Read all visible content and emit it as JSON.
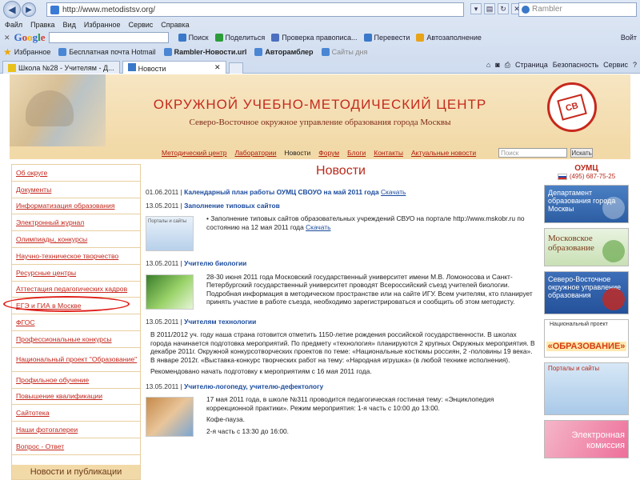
{
  "browser": {
    "url": "http://www.metodistsv.org/",
    "search_placeholder": "Rambler",
    "menu": [
      "Файл",
      "Правка",
      "Вид",
      "Избранное",
      "Сервис",
      "Справка"
    ],
    "google_toolbar": {
      "logo": [
        "G",
        "o",
        "o",
        "g",
        "l",
        "e"
      ],
      "items": [
        "Поиск",
        "Поделиться",
        "Проверка правописа...",
        "Перевести",
        "Автозаполнение"
      ],
      "signin": "Войт"
    },
    "favorites": {
      "label": "Избранное",
      "items": [
        "Бесплатная почта Hotmail",
        "Rambler-Новости.url",
        "Авторамблер",
        "Сайты дня"
      ]
    },
    "tabs": [
      {
        "label": "Школа №28 - Учителям - Д..."
      },
      {
        "label": "Новости"
      }
    ],
    "command_bar": [
      "Страница",
      "Безопасность",
      "Сервис"
    ]
  },
  "header": {
    "title": "ОКРУЖНОЙ УЧЕБНО-МЕТОДИЧЕСКИЙ ЦЕНТР",
    "subtitle": "Северо-Восточное окружное управление образования города Москвы",
    "logo_text": "СВ"
  },
  "topnav": {
    "links": [
      "Методический центр",
      "Лаборатории",
      "Новости",
      "Форум",
      "Блоги",
      "Контакты",
      "Актуальные новости"
    ],
    "search_placeholder": "Поиск",
    "search_button": "Искать"
  },
  "sidebar": {
    "items": [
      "Об округе",
      "Документы",
      "Информатизация образования",
      "Электронный журнал",
      "Олимпиады, конкурсы",
      "Научно-техническое творчество",
      "Ресурсные центры",
      "Аттестация педагогических кадров",
      "ЕГЭ и ГИА в Москве",
      "ФГОС",
      "Профессиональные конкурсы",
      "Национальный проект \"Образование\"",
      "Профильное обучение",
      "Повышение квалификации",
      "Сайтотека",
      "Наши фотогалереи",
      "Вопрос - Ответ"
    ],
    "footer": "Новости и публикации"
  },
  "main": {
    "title": "Новости",
    "news": [
      {
        "date": "01.06.2011",
        "head": "Календарный план работы ОУМЦ СВОУО на май 2011 года",
        "link": "Скачать"
      },
      {
        "date": "13.05.2011",
        "head": "Заполнение типовых сайтов",
        "thumb_label": "Порталы и сайты",
        "text": "Заполнение типовых сайтов образовательных учреждений СВУО на портале http://www.mskobr.ru по состоянию на 12 мая 2011 года",
        "link": "Скачать"
      },
      {
        "date": "13.05.2011",
        "head": "Учителю биологии",
        "text": "28-30 июня 2011 года Московский государственный университет имени М.В. Ломоносова и Санкт-Петербургский государственный университет проводят Всероссийский съезд учителей биологии. Подробная информация в методическом пространстве или на сайте ИГУ. Всем учителям, кто планирует принять участие в работе съезда, необходимо зарегистрироваться и сообщить об этом методисту."
      },
      {
        "date": "13.05.2011",
        "head": "Учителям технологии",
        "text": "В 2011/2012 уч. году наша страна готовится отметить 1150-летие рождения российской государственности. В школах города начинается подготовка мероприятий. По предмету «технология» планируются 2 крупных Окружных мероприятия. В декабре 2011г. Окружной конкурсотворческих проектов по теме: «Национальные костюмы россиян, 2 -половины 19 века». В январе 2012г. «Выставка-конкурс творческих работ на тему: «Народная игрушка» (в любой технике исполнения).",
        "text2": "Рекомендовано начать подготовку к мероприятиям с 16 мая 2011 года."
      },
      {
        "date": "13.05.2011",
        "head": "Учителю-логопеду, учителю-дефектологу",
        "text": "17 мая 2011 года, в школе №311 проводится педагогическая гостиная тему: «Энциклопедия коррекционной практики». Режим мероприятия: 1-я часть с 10:00 до 13:00.",
        "text2": "Кофе-пауза.",
        "text3": "2-я часть   с 13:30 до 16:00."
      }
    ]
  },
  "rightbar": {
    "title": "ОУМЦ",
    "phone": "(495) 687-75-25",
    "banner1": "Департамент образования города Москвы",
    "banner2": "Московское образование",
    "banner3": "Северо-Восточное окружное управление образования",
    "banner4_small": "Национальный проект",
    "banner4_big": "«ОБРАЗОВАНИЕ»",
    "banner5": "Порталы и сайты",
    "banner6": "Электронная комиссия"
  },
  "colors": {
    "accent_red": "#c42a1c",
    "header_bg": "#f2d9a8",
    "link_blue": "#1a4a9c",
    "highlight": "#e0201a"
  }
}
